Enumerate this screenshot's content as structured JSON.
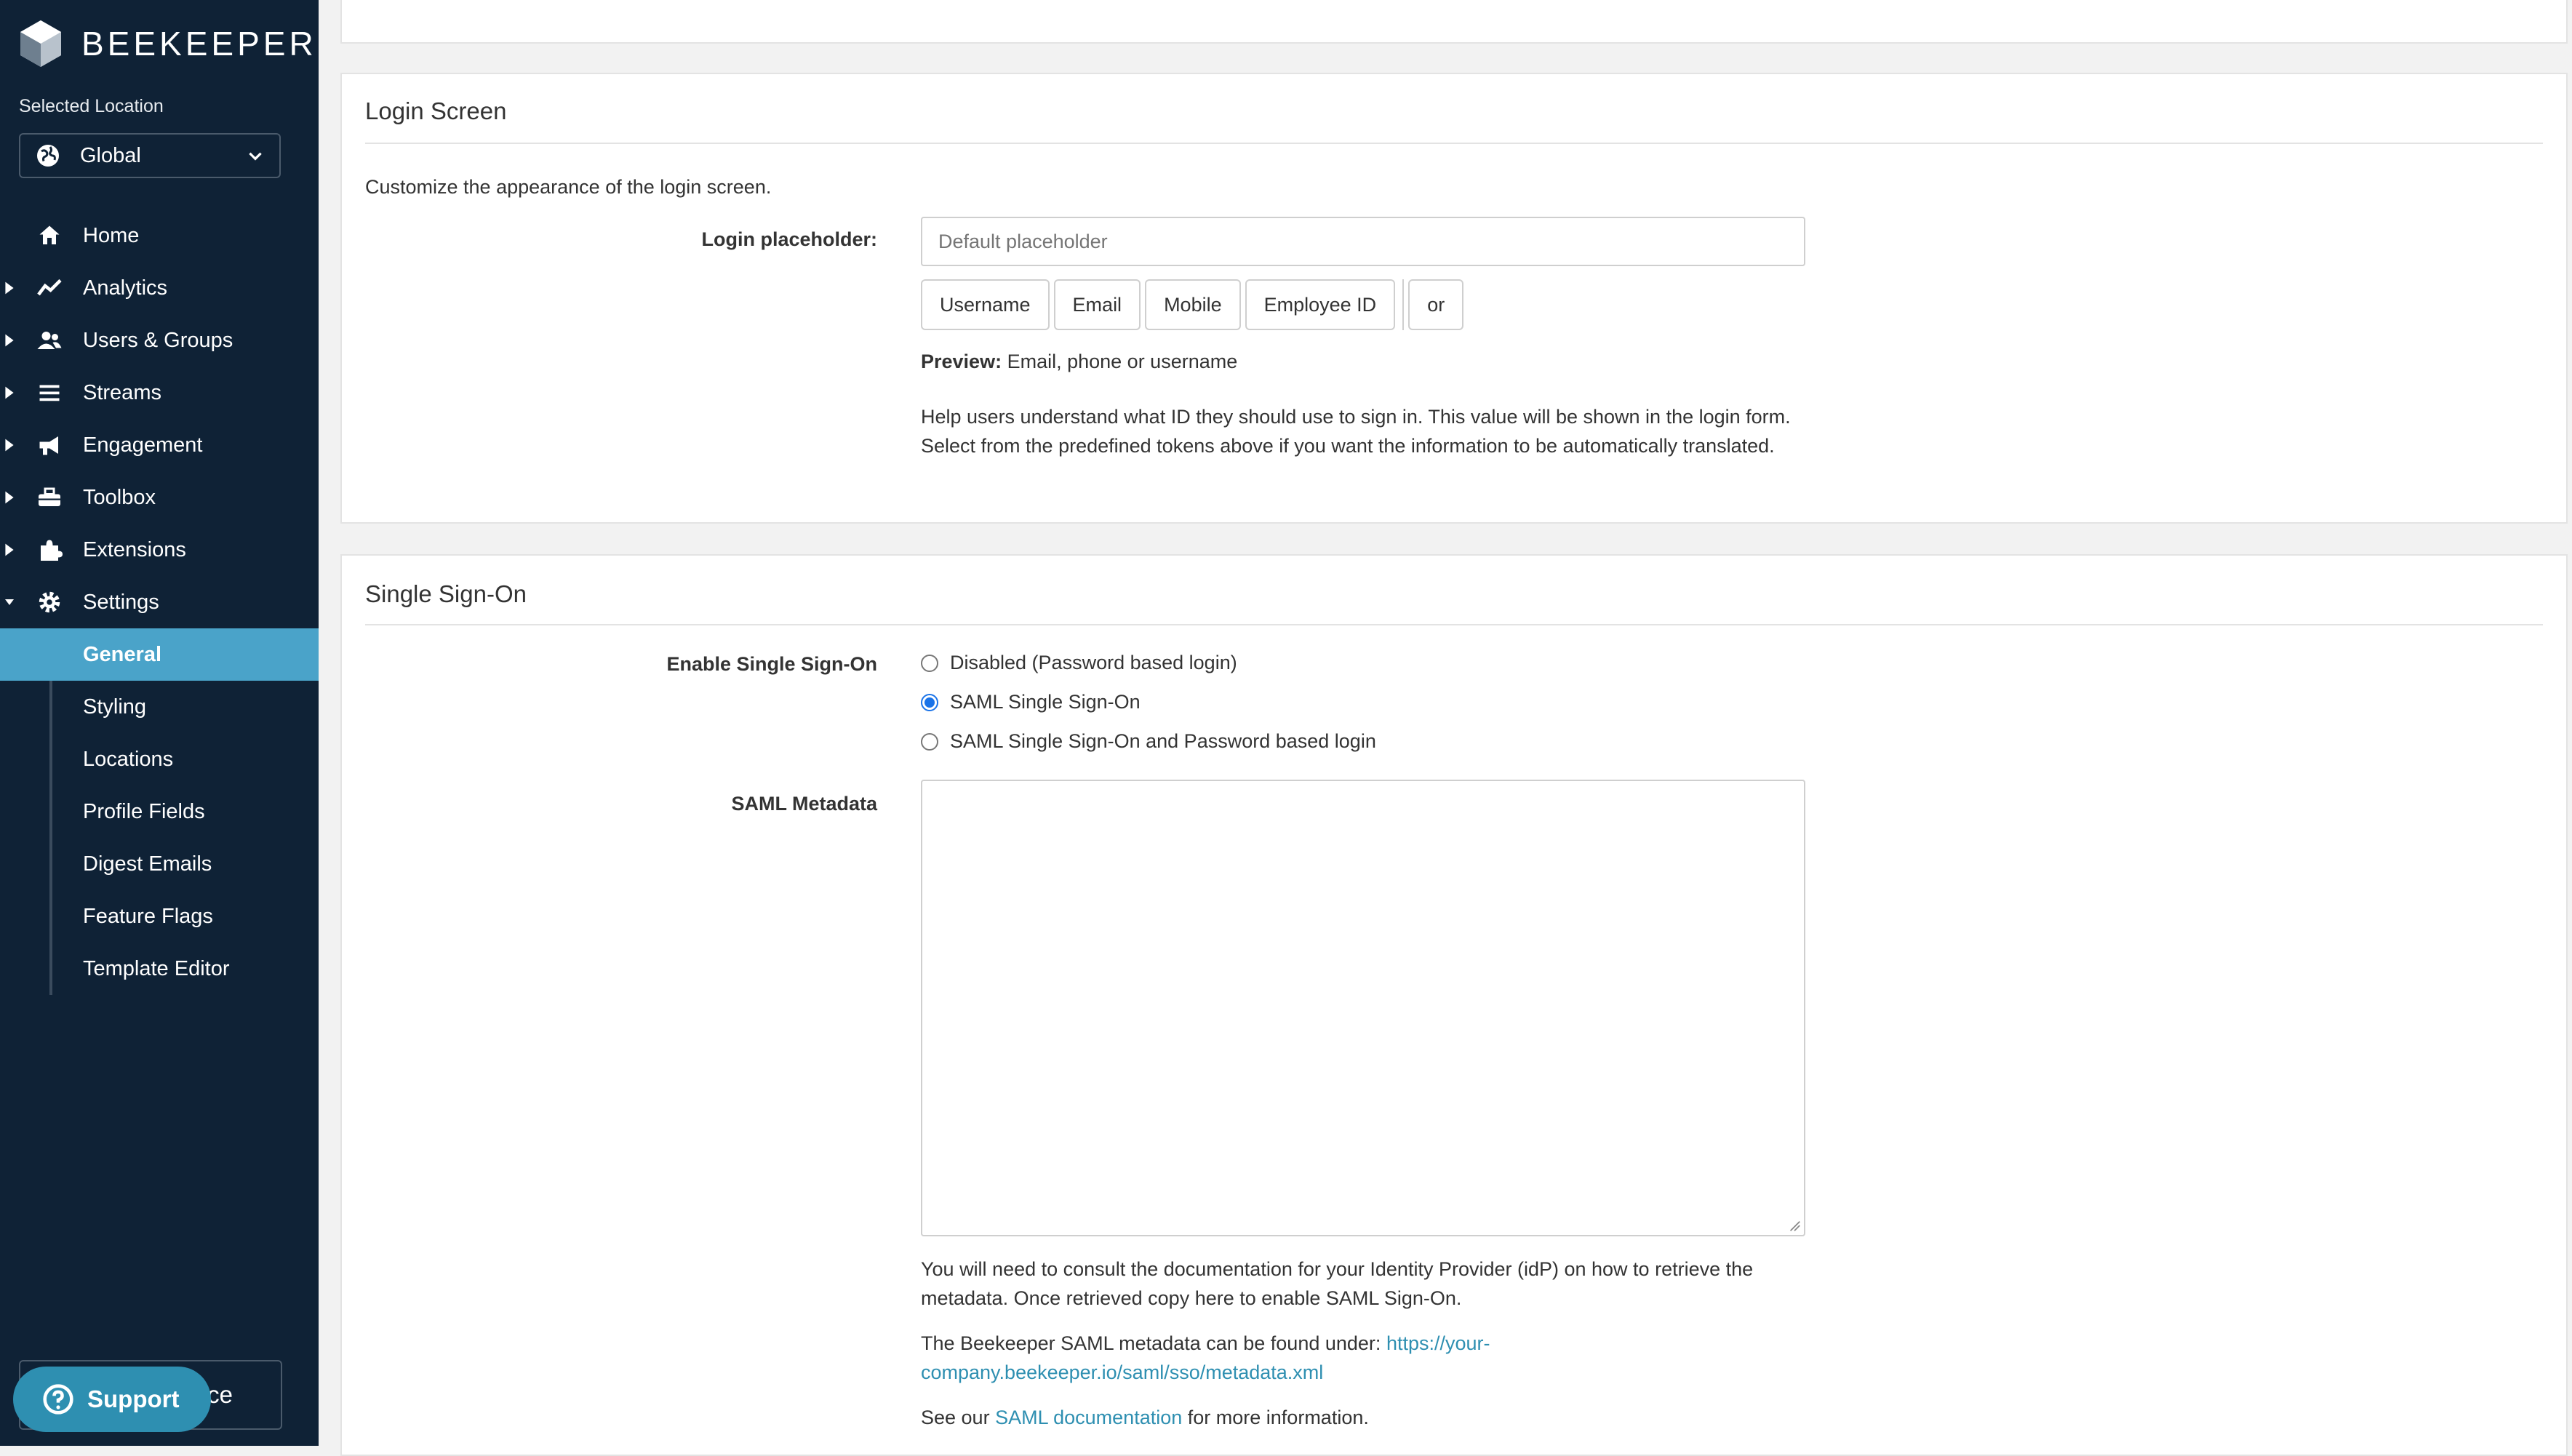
{
  "sidebar": {
    "brand": "BEEKEEPER",
    "selected_location_label": "Selected Location",
    "location_value": "Global",
    "nav": [
      {
        "label": "Home",
        "icon": "home-icon",
        "caret": false
      },
      {
        "label": "Analytics",
        "icon": "analytics-icon",
        "caret": true
      },
      {
        "label": "Users & Groups",
        "icon": "users-icon",
        "caret": true
      },
      {
        "label": "Streams",
        "icon": "streams-icon",
        "caret": true
      },
      {
        "label": "Engagement",
        "icon": "megaphone-icon",
        "caret": true
      },
      {
        "label": "Toolbox",
        "icon": "toolbox-icon",
        "caret": true
      },
      {
        "label": "Extensions",
        "icon": "puzzle-icon",
        "caret": true
      },
      {
        "label": "Settings",
        "icon": "gear-icon",
        "caret": true,
        "expanded": true
      }
    ],
    "settings_sub": [
      {
        "label": "General",
        "active": true
      },
      {
        "label": "Styling"
      },
      {
        "label": "Locations"
      },
      {
        "label": "Profile Fields"
      },
      {
        "label": "Digest Emails"
      },
      {
        "label": "Feature Flags"
      },
      {
        "label": "Template Editor"
      }
    ],
    "community_partial": "ce",
    "support_label": "Support"
  },
  "login_screen": {
    "title": "Login Screen",
    "description": "Customize the appearance of the login screen.",
    "placeholder_label": "Login placeholder:",
    "placeholder_hint": "Default placeholder",
    "tokens": [
      "Username",
      "Email",
      "Mobile",
      "Employee ID"
    ],
    "token_or": "or",
    "preview_label": "Preview:",
    "preview_value": "Email, phone or username",
    "help_line1": "Help users understand what ID they should use to sign in. This value will be shown in the login form.",
    "help_line2": "Select from the predefined tokens above if you want the information to be automatically translated."
  },
  "sso": {
    "title": "Single Sign-On",
    "enable_label": "Enable Single Sign-On",
    "options": [
      {
        "label": "Disabled (Password based login)",
        "checked": false
      },
      {
        "label": "SAML Single Sign-On",
        "checked": true
      },
      {
        "label": "SAML Single Sign-On and Password based login",
        "checked": false
      }
    ],
    "metadata_label": "SAML Metadata",
    "help1_line1": "You will need to consult the documentation for your Identity Provider (idP) on how to retrieve the",
    "help1_line2": "metadata. Once retrieved copy here to enable SAML Sign-On.",
    "help2_prefix": "The Beekeeper SAML metadata can be found under:",
    "help2_link_part1": "https://your-",
    "help2_link_part2": "company.beekeeper.io/saml/sso/metadata.xml",
    "help3_prefix": "See our",
    "help3_link": "SAML documentation",
    "help3_suffix": "for more information."
  },
  "colors": {
    "sidebar_bg": "#0f2236",
    "active_item": "#4aa3c9",
    "link": "#2e8fb1",
    "radio_checked": "#1a73e8"
  }
}
